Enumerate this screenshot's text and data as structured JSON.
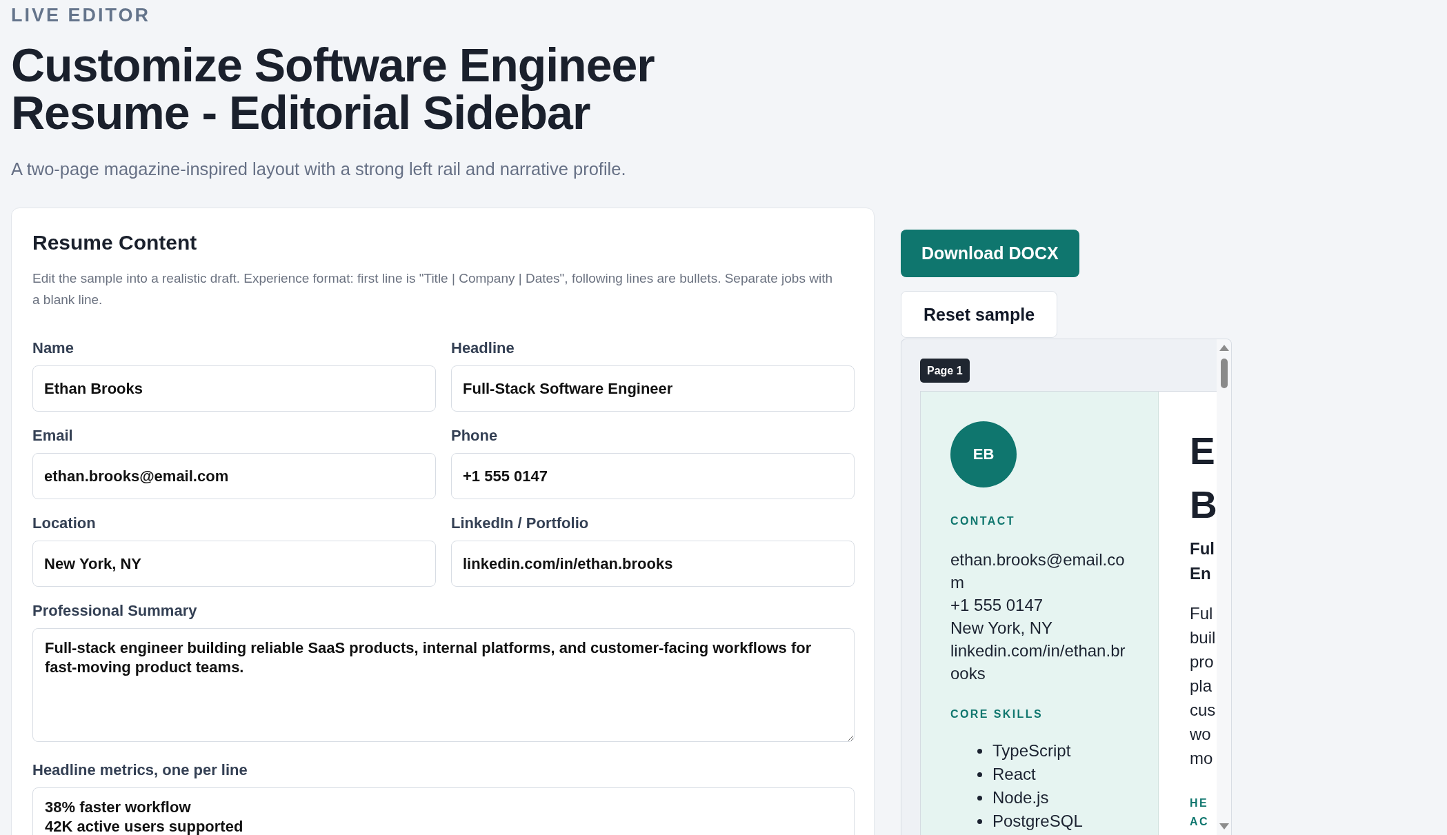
{
  "header": {
    "eyebrow": "LIVE EDITOR",
    "title": "Customize Software Engineer Resume - Editorial Sidebar",
    "subtitle": "A two-page magazine-inspired layout with a strong left rail and narrative profile."
  },
  "editor": {
    "title": "Resume Content",
    "description": "Edit the sample into a realistic draft. Experience format: first line is \"Title | Company | Dates\", following lines are bullets. Separate jobs with a blank line.",
    "fields": [
      {
        "kind": "input",
        "label": "Name",
        "value": "Ethan Brooks"
      },
      {
        "kind": "input",
        "label": "Headline",
        "value": "Full-Stack Software Engineer"
      },
      {
        "kind": "input",
        "label": "Email",
        "value": "ethan.brooks@email.com"
      },
      {
        "kind": "input",
        "label": "Phone",
        "value": "+1 555 0147"
      },
      {
        "kind": "input",
        "label": "Location",
        "value": "New York, NY"
      },
      {
        "kind": "input",
        "label": "LinkedIn / Portfolio",
        "value": "linkedin.com/in/ethan.brooks"
      },
      {
        "kind": "textarea",
        "label": "Professional Summary",
        "value": "Full-stack engineer building reliable SaaS products, internal platforms, and customer-facing workflows for fast-moving product teams."
      },
      {
        "kind": "textarea",
        "label": "Headline metrics, one per line",
        "value": "38% faster workflow\n42K active users supported"
      }
    ]
  },
  "actions": [
    {
      "kind": "primary",
      "label": "Download DOCX"
    },
    {
      "kind": "secondary",
      "label": "Reset sample"
    }
  ],
  "preview": {
    "page_label": "Page 1",
    "avatar_initials": "EB",
    "sidebar_sections": [
      {
        "kind": "lines",
        "heading": "CONTACT",
        "items": [
          "ethan.brooks@email.com",
          "+1 555 0147",
          "New York, NY",
          "linkedin.com/in/ethan.brooks"
        ]
      },
      {
        "kind": "bullets",
        "heading": "CORE SKILLS",
        "items": [
          "TypeScript",
          "React",
          "Node.js",
          "PostgreSQL"
        ]
      }
    ],
    "main_column": {
      "name_lines": [
        "E",
        "B"
      ],
      "headline_lines": [
        "Ful",
        "En"
      ],
      "summary_lines": [
        "Ful",
        "buil",
        "pro",
        "pla",
        "cus",
        "wo",
        "mo"
      ],
      "heading_lines": [
        "HE",
        "AC"
      ]
    }
  }
}
